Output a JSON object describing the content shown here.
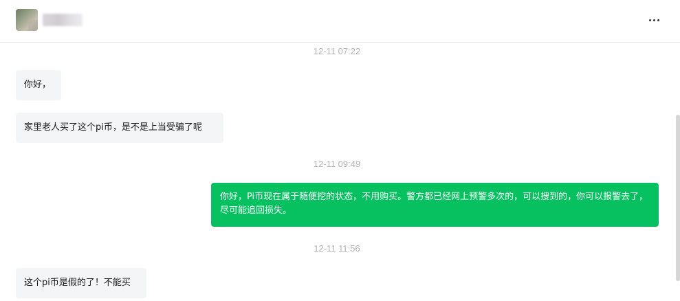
{
  "header": {
    "contact_name": "",
    "more_icon": "more-horizontal-icon"
  },
  "messages": [
    {
      "type": "timestamp",
      "text": "12-11 07:22"
    },
    {
      "type": "incoming",
      "text": "你好，"
    },
    {
      "type": "incoming",
      "text": "家里老人买了这个pi币，是不是上当受骗了呢"
    },
    {
      "type": "timestamp",
      "text": "12-11 09:49"
    },
    {
      "type": "outgoing",
      "text": "你好，Pi币现在属于随便挖的状态，不用购买。警方都已经网上预警多次的，可以搜到的，你可以报警去了，尽可能追回损失。"
    },
    {
      "type": "timestamp",
      "text": "12-11 11:56"
    },
    {
      "type": "incoming",
      "text": "这个pi币是假的了！不能买"
    }
  ],
  "colors": {
    "outgoing_bubble": "#07c160",
    "incoming_bubble": "#f4f5f7",
    "timestamp_text": "#b2b2b2"
  }
}
